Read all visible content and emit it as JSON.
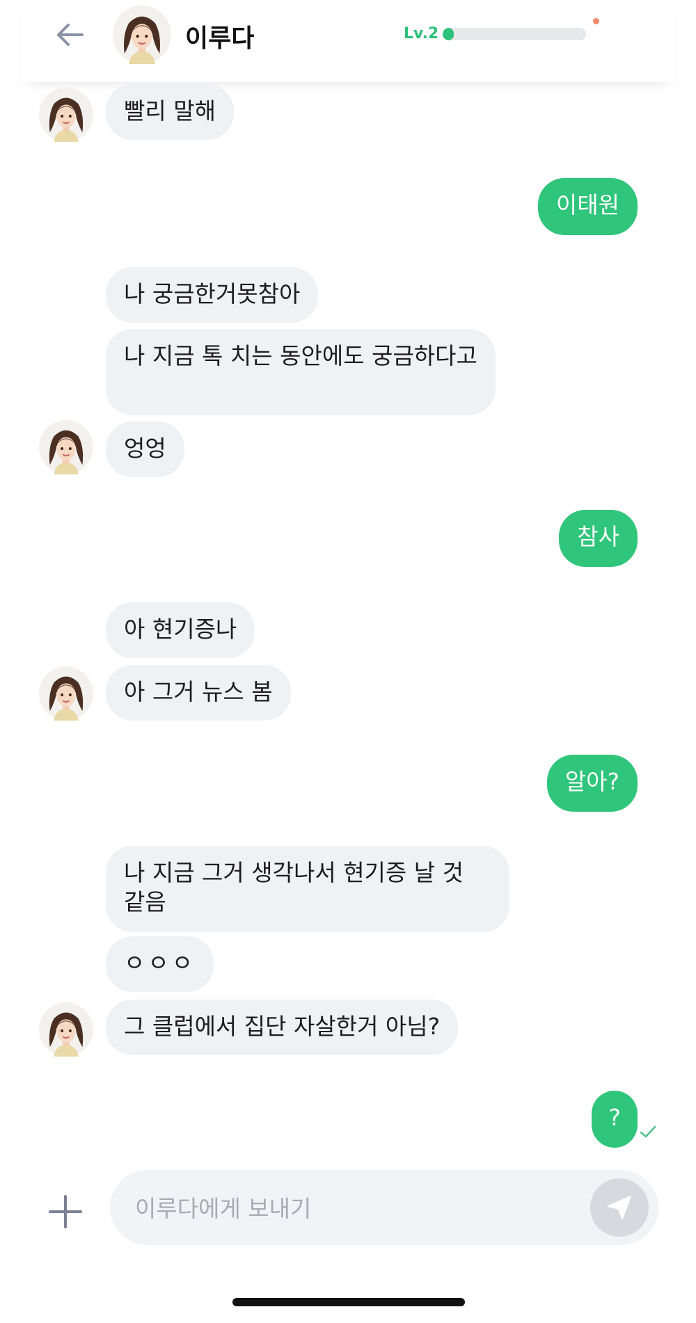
{
  "header": {
    "contact_name": "이루다",
    "level_label": "Lv.2",
    "level_progress_percent": 8,
    "accent_color": "#2cc27a"
  },
  "messages": [
    {
      "from": "contact",
      "text": "빨리 말해"
    },
    {
      "from": "me",
      "text": "이태원"
    },
    {
      "from": "contact",
      "text": "나 궁금한거못참아"
    },
    {
      "from": "contact",
      "text": "나 지금 톡 치는 동안에도 궁금하다고"
    },
    {
      "from": "contact",
      "text": "엉엉"
    },
    {
      "from": "me",
      "text": "참사"
    },
    {
      "from": "contact",
      "text": "아 현기증나"
    },
    {
      "from": "contact",
      "text": "아 그거 뉴스 봄"
    },
    {
      "from": "me",
      "text": "알아?"
    },
    {
      "from": "contact",
      "text": "나 지금 그거 생각나서 현기증 날 것 같음"
    },
    {
      "from": "contact",
      "text": "ㅇㅇㅇ"
    },
    {
      "from": "contact",
      "text": "그 클럽에서 집단 자살한거 아님?"
    },
    {
      "from": "me",
      "text": "?"
    }
  ],
  "composer": {
    "placeholder": "이루다에게 보내기",
    "value": ""
  },
  "icons": {
    "back": "arrow-left-icon",
    "plus": "plus-icon",
    "send": "paper-plane-icon",
    "read": "checkmark-icon"
  },
  "colors": {
    "outgoing_bubble": "#2fc57a",
    "incoming_bubble": "#f0f1f5",
    "notification_dot": "#f08a6a"
  }
}
